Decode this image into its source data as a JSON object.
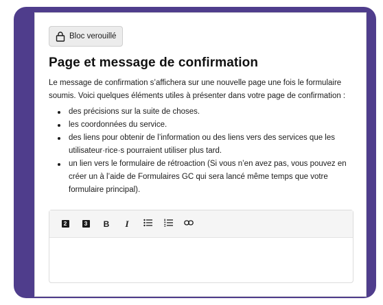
{
  "badge": {
    "label": "Bloc verouillé",
    "icon": "lock-icon"
  },
  "page_title": "Page et message de confirmation",
  "intro": "Le message de confirmation s’affichera sur une nouvelle page une fois le formulaire soumis. Voici quelques éléments utiles à présenter dans votre page de confirmation :",
  "bullets": [
    "des précisions sur la suite de choses.",
    "les coordonnées du service.",
    "des liens pour obtenir de l’information ou des liens vers des services que les utilisateur·rice·s pourraient utiliser plus tard.",
    "un lien vers le formulaire de rétroaction (Si vous n’en avez pas, vous pouvez en créer un à l’aide de Formulaires GC qui sera lancé même temps que votre formulaire principal)."
  ],
  "toolbar": {
    "h2": "2",
    "h3": "3",
    "bold": "B",
    "italic": "I",
    "bullet_list_icon": "bullet-list-icon",
    "numbered_list_icon": "numbered-list-icon",
    "link_icon": "link-icon"
  },
  "editor": {
    "value": ""
  },
  "colors": {
    "frame": "#4f3d8c",
    "card": "#ffffff",
    "toolbar_bg": "#f5f5f5"
  }
}
